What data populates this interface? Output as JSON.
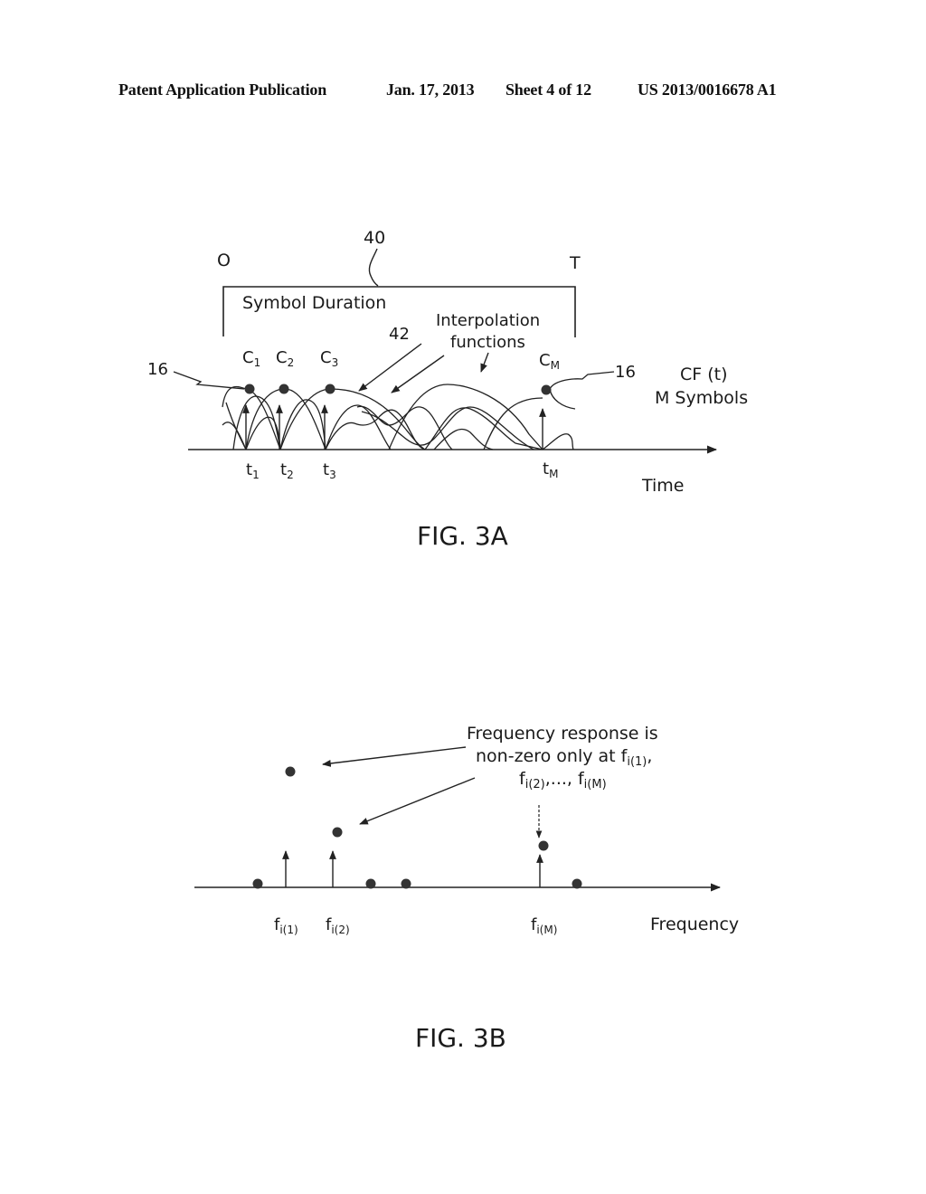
{
  "header": {
    "publication_type": "Patent Application Publication",
    "date": "Jan. 17, 2013",
    "sheet": "Sheet 4 of 12",
    "patent_number": "US 2013/0016678 A1"
  },
  "fig3a": {
    "caption": "FIG. 3A",
    "origin_label": "O",
    "end_label": "T",
    "bracket_ref": "40",
    "bracket_label": "Symbol Duration",
    "ref_42": "42",
    "interp_label_line1": "Interpolation",
    "interp_label_line2": "functions",
    "ref_16_left": "16",
    "ref_16_right": "16",
    "symbols": [
      {
        "coef": "C",
        "sub": "1",
        "time": "t",
        "tsub": "1"
      },
      {
        "coef": "C",
        "sub": "2",
        "time": "t",
        "tsub": "2"
      },
      {
        "coef": "C",
        "sub": "3",
        "time": "t",
        "tsub": "3"
      },
      {
        "coef": "C",
        "sub": "M",
        "time": "t",
        "tsub": "M"
      }
    ],
    "signal_label_line1": "CF (t)",
    "signal_label_line2": "M Symbols",
    "axis_label": "Time"
  },
  "fig3b": {
    "caption": "FIG. 3B",
    "annotation_line1": "Frequency response is",
    "annotation_line2_text": "non-zero only at f",
    "annotation_line2_sub": "i(1)",
    "annotation_line3_f1": "f",
    "annotation_line3_sub1": "i(2)",
    "annotation_line3_mid": ",..., f",
    "annotation_line3_sub2": "i(M)",
    "freq_labels": [
      {
        "f": "f",
        "sub": "i(1)"
      },
      {
        "f": "f",
        "sub": "i(2)"
      },
      {
        "f": "f",
        "sub": "i(M)"
      }
    ],
    "axis_label": "Frequency"
  }
}
